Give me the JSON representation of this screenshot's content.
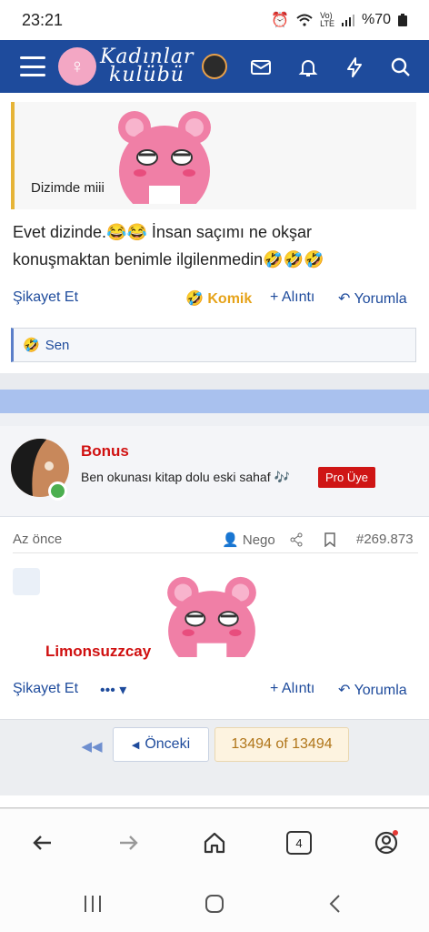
{
  "status": {
    "time": "23:21",
    "battery": "%70"
  },
  "nav": {
    "logo_line1": "Kadınlar",
    "logo_line2": "kulübü"
  },
  "post1": {
    "quote_text": "Dizimde miii",
    "message": "Evet dizinde.😂😂 İnsan saçımı ne okşar konuşmaktan benimle ilgilenmedin🤣🤣🤣",
    "report": "Şikayet Et",
    "reaction": "Komik",
    "quote_btn": "+ Alıntı",
    "reply_btn": "Yorumla",
    "reacted_by": "Sen"
  },
  "post2": {
    "username": "Bonus",
    "user_title": "Ben okunası kitap dolu eski sahaf 🎶",
    "badge": "Pro Üye",
    "time": "Az önce",
    "quoted_user": "Nego",
    "post_number": "#269.873",
    "sticker_caption": "Limonsuzzcay",
    "report": "Şikayet Et",
    "more": "•••",
    "quote_btn": "+ Alıntı",
    "reply_btn": "Yorumla"
  },
  "pagination": {
    "prev": "Önceki",
    "page": "13494 of 13494"
  },
  "browser": {
    "tab_count": "4"
  },
  "colors": {
    "brand": "#1e4b9c",
    "accent_red": "#cf1515",
    "quote_border": "#e6b437"
  }
}
